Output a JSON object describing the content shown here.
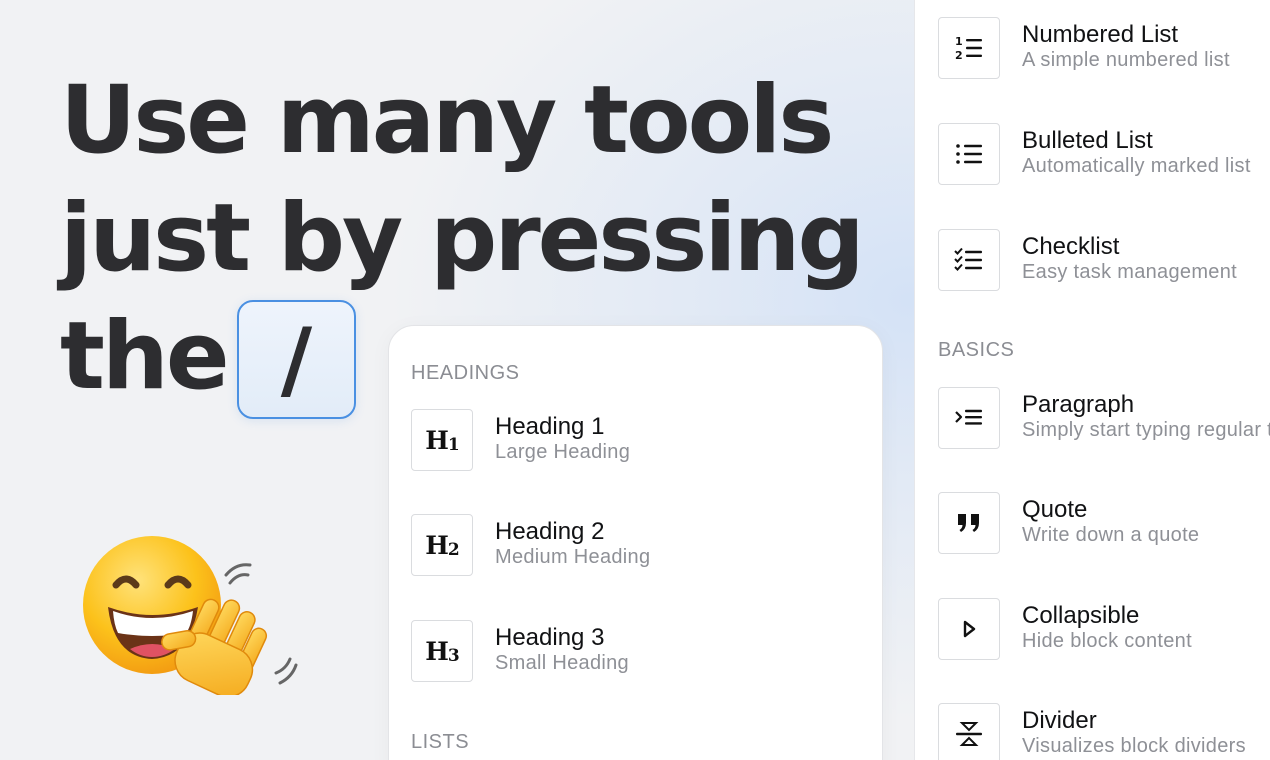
{
  "hero": {
    "line1": "Use many tools",
    "line2": "just by pressing",
    "line3": "the",
    "key": "/"
  },
  "menu": {
    "headings_label": "HEADINGS",
    "lists_label": "LISTS",
    "items": [
      {
        "title": "Heading 1",
        "desc": "Large Heading",
        "glyph": "H",
        "num": "1",
        "icon": "heading-1-icon"
      },
      {
        "title": "Heading 2",
        "desc": "Medium Heading",
        "glyph": "H",
        "num": "2",
        "icon": "heading-2-icon"
      },
      {
        "title": "Heading 3",
        "desc": "Small Heading",
        "glyph": "H",
        "num": "3",
        "icon": "heading-3-icon"
      }
    ]
  },
  "panel": {
    "basics_label": "BASICS",
    "lists": [
      {
        "title": "Numbered List",
        "desc": "A simple numbered list",
        "icon": "numbered-list-icon"
      },
      {
        "title": "Bulleted List",
        "desc": "Automatically marked list",
        "icon": "bulleted-list-icon"
      },
      {
        "title": "Checklist",
        "desc": "Easy task management",
        "icon": "checklist-icon"
      }
    ],
    "basics": [
      {
        "title": "Paragraph",
        "desc": "Simply start typing regular text",
        "icon": "paragraph-icon"
      },
      {
        "title": "Quote",
        "desc": "Write down a quote",
        "icon": "quote-icon"
      },
      {
        "title": "Collapsible",
        "desc": "Hide block content",
        "icon": "collapsible-icon"
      },
      {
        "title": "Divider",
        "desc": "Visualizes block dividers",
        "icon": "divider-icon"
      }
    ]
  },
  "emoji": {
    "icon": "smiling-face-waving-hand-icon"
  }
}
